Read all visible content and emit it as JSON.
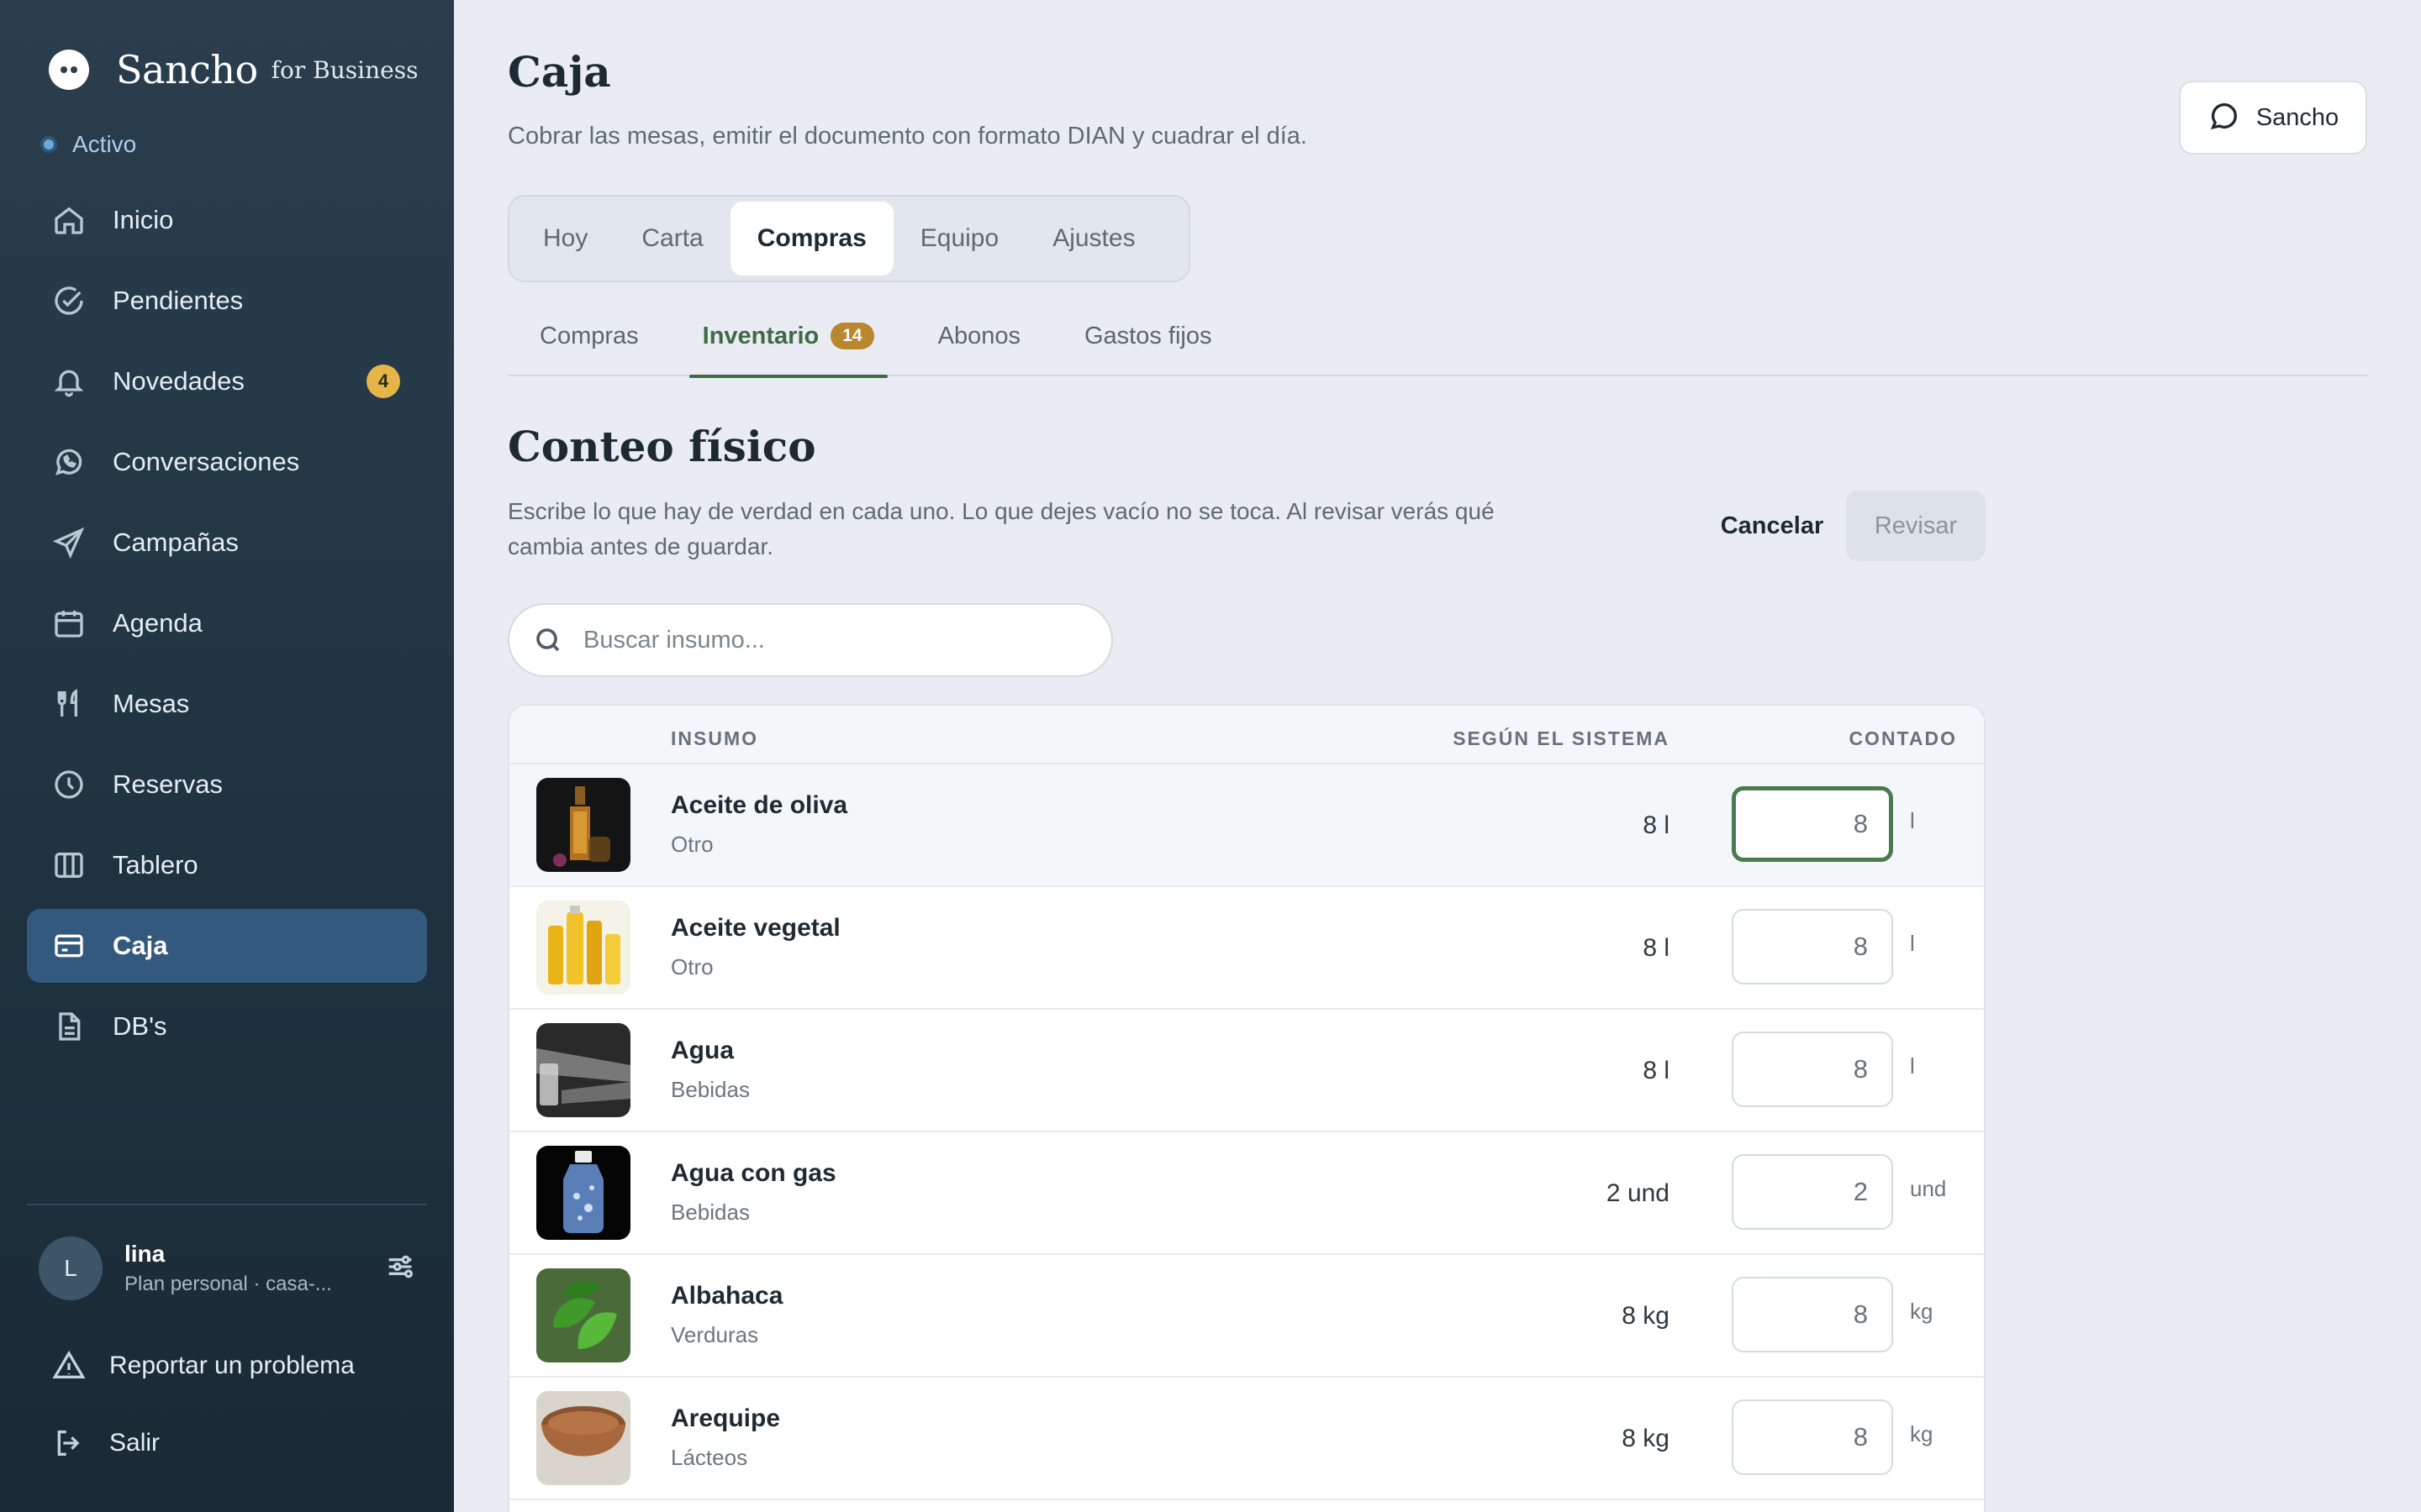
{
  "sidebar": {
    "brand": {
      "name": "Sancho",
      "suffix": "for Business"
    },
    "status": "Activo",
    "items": [
      {
        "label": "Inicio",
        "icon": "home-icon"
      },
      {
        "label": "Pendientes",
        "icon": "check-circle-icon"
      },
      {
        "label": "Novedades",
        "icon": "bell-icon",
        "badge": "4"
      },
      {
        "label": "Conversaciones",
        "icon": "whatsapp-icon"
      },
      {
        "label": "Campañas",
        "icon": "send-icon"
      },
      {
        "label": "Agenda",
        "icon": "calendar-icon"
      },
      {
        "label": "Mesas",
        "icon": "utensils-icon"
      },
      {
        "label": "Reservas",
        "icon": "clock-icon"
      },
      {
        "label": "Tablero",
        "icon": "columns-icon"
      },
      {
        "label": "Caja",
        "icon": "credit-card-icon",
        "active": true
      },
      {
        "label": "DB's",
        "icon": "file-icon"
      }
    ],
    "user": {
      "initial": "L",
      "name": "lina",
      "plan": "Plan personal · casa-..."
    },
    "report_label": "Reportar un problema",
    "logout_label": "Salir"
  },
  "header": {
    "title": "Caja",
    "subtitle": "Cobrar las mesas, emitir el documento con formato DIAN y cuadrar el día.",
    "assistant_button": "Sancho"
  },
  "tabs": [
    "Hoy",
    "Carta",
    "Compras",
    "Equipo",
    "Ajustes"
  ],
  "active_tab": "Compras",
  "subtabs": [
    {
      "label": "Compras"
    },
    {
      "label": "Inventario",
      "badge": "14",
      "active": true
    },
    {
      "label": "Abonos"
    },
    {
      "label": "Gastos fijos"
    }
  ],
  "count": {
    "title": "Conteo físico",
    "description": "Escribe lo que hay de verdad en cada uno. Lo que dejes vacío no se toca. Al revisar verás qué cambia antes de guardar.",
    "cancel_label": "Cancelar",
    "review_label": "Revisar",
    "search_placeholder": "Buscar insumo..."
  },
  "table": {
    "headers": {
      "insumo": "INSUMO",
      "sistema": "SEGÚN EL SISTEMA",
      "contado": "CONTADO"
    },
    "rows": [
      {
        "name": "Aceite de oliva",
        "category": "Otro",
        "system": "8 l",
        "counted": "8",
        "unit": "l",
        "focused": true
      },
      {
        "name": "Aceite vegetal",
        "category": "Otro",
        "system": "8 l",
        "counted": "8",
        "unit": "l"
      },
      {
        "name": "Agua",
        "category": "Bebidas",
        "system": "8 l",
        "counted": "8",
        "unit": "l"
      },
      {
        "name": "Agua con gas",
        "category": "Bebidas",
        "system": "2 und",
        "counted": "2",
        "unit": "und"
      },
      {
        "name": "Albahaca",
        "category": "Verduras",
        "system": "8 kg",
        "counted": "8",
        "unit": "kg"
      },
      {
        "name": "Arequipe",
        "category": "Lácteos",
        "system": "8 kg",
        "counted": "8",
        "unit": "kg"
      }
    ]
  },
  "colors": {
    "accent": "#3e6b45",
    "sidebar_active": "#335a7e",
    "badge": "#e5b548",
    "subtab_badge": "#b8872e"
  }
}
